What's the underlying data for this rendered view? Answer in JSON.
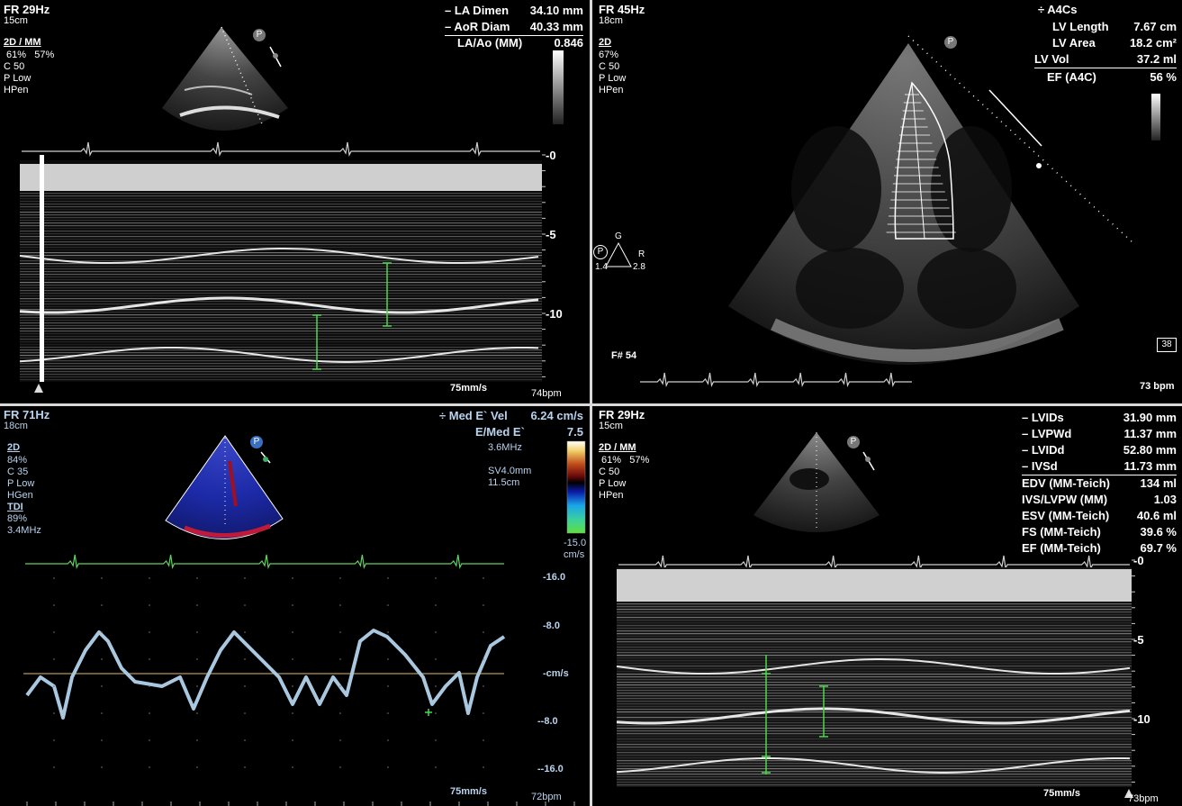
{
  "panel_tl": {
    "frame_rate": "FR 29Hz",
    "depth": "15cm",
    "mode": "2D / MM",
    "gain": " 61%   57%",
    "compression": "C 50",
    "power": "P Low",
    "harmonic": "HPen",
    "measurements": [
      {
        "label": "– LA Dimen",
        "value": "34.10 mm"
      },
      {
        "label": "– AoR Diam",
        "value": "40.33 mm"
      },
      {
        "label": "LA/Ao (MM)",
        "value": "0.846"
      }
    ],
    "depth_marks": [
      "-0",
      "-5",
      "-10"
    ],
    "sweep": "75mm/s",
    "heart_rate": "74bpm",
    "probe_badge": "P"
  },
  "panel_tr": {
    "frame_rate": "FR 45Hz",
    "depth": "18cm",
    "mode": "2D",
    "gain": "67%",
    "compression": "C 50",
    "power": "P Low",
    "harmonic": "HPen",
    "view_label": "÷ A4Cs",
    "measurements": [
      {
        "label": "LV Length",
        "value": "7.67 cm"
      },
      {
        "label": "LV Area",
        "value": "18.2 cm²"
      },
      {
        "label": "LV Vol",
        "value": "37.2 ml"
      },
      {
        "label": "EF (A4C)",
        "value": "56 %"
      }
    ],
    "orientation": {
      "top": "G",
      "right": "R",
      "left_num": "1.4",
      "right_num": "2.8",
      "badge": "P"
    },
    "frame_number": "F# 54",
    "temperature": "38",
    "heart_rate": "73 bpm",
    "probe_badge": "P"
  },
  "panel_bl": {
    "frame_rate": "FR 71Hz",
    "depth": "18cm",
    "mode": "2D",
    "gain": " 84%",
    "compression": "C 35",
    "power": "P Low",
    "harmonic": "HGen",
    "tdi_label": "TDI",
    "tdi_gain": " 89%",
    "tdi_freq": "3.4MHz",
    "measurements": [
      {
        "label": "÷ Med E` Vel",
        "value": "6.24 cm/s"
      },
      {
        "label": "E/Med E`",
        "value": "7.5"
      }
    ],
    "doppler_freq": "3.6MHz",
    "sample_volume": "SV4.0mm",
    "sample_depth": "11.5cm",
    "scale_max": "7.5",
    "scale_min": "-15.0",
    "scale_unit": "cm/s",
    "velocity_marks": [
      "-16.0",
      "-8.0",
      "-cm/s",
      "--8.0",
      "--16.0"
    ],
    "sweep": "75mm/s",
    "heart_rate": "72bpm",
    "probe_badge": "P"
  },
  "panel_br": {
    "frame_rate": "FR 29Hz",
    "depth": "15cm",
    "mode": "2D / MM",
    "gain": " 61%   57%",
    "compression": "C 50",
    "power": "P Low",
    "harmonic": "HPen",
    "measurements": [
      {
        "label": "– LVIDs",
        "value": "31.90 mm"
      },
      {
        "label": "– LVPWd",
        "value": "11.37 mm"
      },
      {
        "label": "– LVIDd",
        "value": "52.80 mm"
      },
      {
        "label": "– IVSd",
        "value": "11.73 mm"
      },
      {
        "label": "EDV (MM-Teich)",
        "value": "134 ml"
      },
      {
        "label": "IVS/LVPW (MM)",
        "value": "1.03"
      },
      {
        "label": "ESV (MM-Teich)",
        "value": "40.6 ml"
      },
      {
        "label": "FS (MM-Teich)",
        "value": "39.6 %"
      },
      {
        "label": "EF (MM-Teich)",
        "value": "69.7 %"
      }
    ],
    "depth_marks": [
      "-0",
      "-5",
      "-10"
    ],
    "sweep": "75mm/s",
    "heart_rate": "73bpm",
    "probe_badge": "P"
  },
  "colors": {
    "background": "#000000",
    "divider": "#d8d8d8",
    "caliper": "#4cd84c",
    "ecg": "#cfcfcf",
    "ecg_tdi": "#5fd35f",
    "tdi_trace": "#a9c8e0",
    "baseline": "#b8925a",
    "text_blue": "#b9d3ee"
  }
}
